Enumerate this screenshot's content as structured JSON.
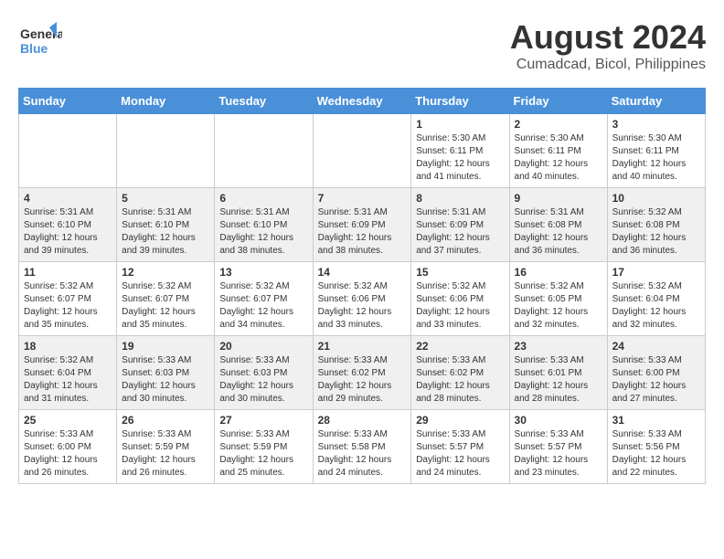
{
  "header": {
    "logo_line1": "General",
    "logo_line2": "Blue",
    "month_year": "August 2024",
    "location": "Cumadcad, Bicol, Philippines"
  },
  "weekdays": [
    "Sunday",
    "Monday",
    "Tuesday",
    "Wednesday",
    "Thursday",
    "Friday",
    "Saturday"
  ],
  "weeks": [
    [
      {
        "day": "",
        "sunrise": "",
        "sunset": "",
        "daylight": ""
      },
      {
        "day": "",
        "sunrise": "",
        "sunset": "",
        "daylight": ""
      },
      {
        "day": "",
        "sunrise": "",
        "sunset": "",
        "daylight": ""
      },
      {
        "day": "",
        "sunrise": "",
        "sunset": "",
        "daylight": ""
      },
      {
        "day": "1",
        "sunrise": "Sunrise: 5:30 AM",
        "sunset": "Sunset: 6:11 PM",
        "daylight": "Daylight: 12 hours and 41 minutes."
      },
      {
        "day": "2",
        "sunrise": "Sunrise: 5:30 AM",
        "sunset": "Sunset: 6:11 PM",
        "daylight": "Daylight: 12 hours and 40 minutes."
      },
      {
        "day": "3",
        "sunrise": "Sunrise: 5:30 AM",
        "sunset": "Sunset: 6:11 PM",
        "daylight": "Daylight: 12 hours and 40 minutes."
      }
    ],
    [
      {
        "day": "4",
        "sunrise": "Sunrise: 5:31 AM",
        "sunset": "Sunset: 6:10 PM",
        "daylight": "Daylight: 12 hours and 39 minutes."
      },
      {
        "day": "5",
        "sunrise": "Sunrise: 5:31 AM",
        "sunset": "Sunset: 6:10 PM",
        "daylight": "Daylight: 12 hours and 39 minutes."
      },
      {
        "day": "6",
        "sunrise": "Sunrise: 5:31 AM",
        "sunset": "Sunset: 6:10 PM",
        "daylight": "Daylight: 12 hours and 38 minutes."
      },
      {
        "day": "7",
        "sunrise": "Sunrise: 5:31 AM",
        "sunset": "Sunset: 6:09 PM",
        "daylight": "Daylight: 12 hours and 38 minutes."
      },
      {
        "day": "8",
        "sunrise": "Sunrise: 5:31 AM",
        "sunset": "Sunset: 6:09 PM",
        "daylight": "Daylight: 12 hours and 37 minutes."
      },
      {
        "day": "9",
        "sunrise": "Sunrise: 5:31 AM",
        "sunset": "Sunset: 6:08 PM",
        "daylight": "Daylight: 12 hours and 36 minutes."
      },
      {
        "day": "10",
        "sunrise": "Sunrise: 5:32 AM",
        "sunset": "Sunset: 6:08 PM",
        "daylight": "Daylight: 12 hours and 36 minutes."
      }
    ],
    [
      {
        "day": "11",
        "sunrise": "Sunrise: 5:32 AM",
        "sunset": "Sunset: 6:07 PM",
        "daylight": "Daylight: 12 hours and 35 minutes."
      },
      {
        "day": "12",
        "sunrise": "Sunrise: 5:32 AM",
        "sunset": "Sunset: 6:07 PM",
        "daylight": "Daylight: 12 hours and 35 minutes."
      },
      {
        "day": "13",
        "sunrise": "Sunrise: 5:32 AM",
        "sunset": "Sunset: 6:07 PM",
        "daylight": "Daylight: 12 hours and 34 minutes."
      },
      {
        "day": "14",
        "sunrise": "Sunrise: 5:32 AM",
        "sunset": "Sunset: 6:06 PM",
        "daylight": "Daylight: 12 hours and 33 minutes."
      },
      {
        "day": "15",
        "sunrise": "Sunrise: 5:32 AM",
        "sunset": "Sunset: 6:06 PM",
        "daylight": "Daylight: 12 hours and 33 minutes."
      },
      {
        "day": "16",
        "sunrise": "Sunrise: 5:32 AM",
        "sunset": "Sunset: 6:05 PM",
        "daylight": "Daylight: 12 hours and 32 minutes."
      },
      {
        "day": "17",
        "sunrise": "Sunrise: 5:32 AM",
        "sunset": "Sunset: 6:04 PM",
        "daylight": "Daylight: 12 hours and 32 minutes."
      }
    ],
    [
      {
        "day": "18",
        "sunrise": "Sunrise: 5:32 AM",
        "sunset": "Sunset: 6:04 PM",
        "daylight": "Daylight: 12 hours and 31 minutes."
      },
      {
        "day": "19",
        "sunrise": "Sunrise: 5:33 AM",
        "sunset": "Sunset: 6:03 PM",
        "daylight": "Daylight: 12 hours and 30 minutes."
      },
      {
        "day": "20",
        "sunrise": "Sunrise: 5:33 AM",
        "sunset": "Sunset: 6:03 PM",
        "daylight": "Daylight: 12 hours and 30 minutes."
      },
      {
        "day": "21",
        "sunrise": "Sunrise: 5:33 AM",
        "sunset": "Sunset: 6:02 PM",
        "daylight": "Daylight: 12 hours and 29 minutes."
      },
      {
        "day": "22",
        "sunrise": "Sunrise: 5:33 AM",
        "sunset": "Sunset: 6:02 PM",
        "daylight": "Daylight: 12 hours and 28 minutes."
      },
      {
        "day": "23",
        "sunrise": "Sunrise: 5:33 AM",
        "sunset": "Sunset: 6:01 PM",
        "daylight": "Daylight: 12 hours and 28 minutes."
      },
      {
        "day": "24",
        "sunrise": "Sunrise: 5:33 AM",
        "sunset": "Sunset: 6:00 PM",
        "daylight": "Daylight: 12 hours and 27 minutes."
      }
    ],
    [
      {
        "day": "25",
        "sunrise": "Sunrise: 5:33 AM",
        "sunset": "Sunset: 6:00 PM",
        "daylight": "Daylight: 12 hours and 26 minutes."
      },
      {
        "day": "26",
        "sunrise": "Sunrise: 5:33 AM",
        "sunset": "Sunset: 5:59 PM",
        "daylight": "Daylight: 12 hours and 26 minutes."
      },
      {
        "day": "27",
        "sunrise": "Sunrise: 5:33 AM",
        "sunset": "Sunset: 5:59 PM",
        "daylight": "Daylight: 12 hours and 25 minutes."
      },
      {
        "day": "28",
        "sunrise": "Sunrise: 5:33 AM",
        "sunset": "Sunset: 5:58 PM",
        "daylight": "Daylight: 12 hours and 24 minutes."
      },
      {
        "day": "29",
        "sunrise": "Sunrise: 5:33 AM",
        "sunset": "Sunset: 5:57 PM",
        "daylight": "Daylight: 12 hours and 24 minutes."
      },
      {
        "day": "30",
        "sunrise": "Sunrise: 5:33 AM",
        "sunset": "Sunset: 5:57 PM",
        "daylight": "Daylight: 12 hours and 23 minutes."
      },
      {
        "day": "31",
        "sunrise": "Sunrise: 5:33 AM",
        "sunset": "Sunset: 5:56 PM",
        "daylight": "Daylight: 12 hours and 22 minutes."
      }
    ]
  ]
}
